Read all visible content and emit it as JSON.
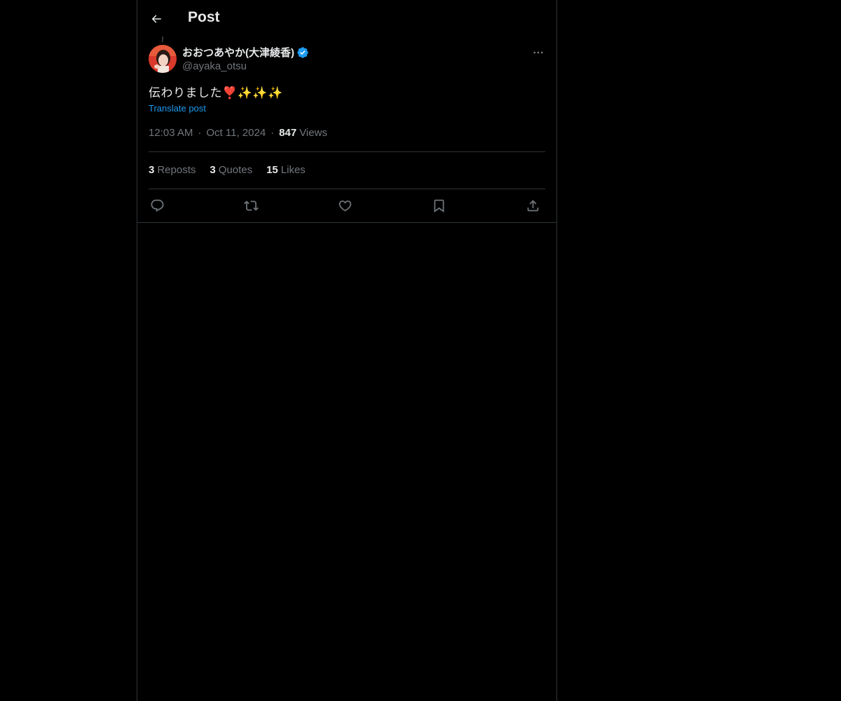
{
  "header": {
    "title": "Post",
    "back_icon": "arrow-left-icon"
  },
  "post": {
    "author": {
      "display_name": "おおつあやか(大津綾香)",
      "handle": "@ayaka_otsu",
      "verified": true
    },
    "text": "伝わりました❣️✨✨✨",
    "translate_label": "Translate post",
    "time": "12:03 AM",
    "date": "Oct 11, 2024",
    "views_count": "847",
    "views_label": "Views"
  },
  "stats": [
    {
      "count": "3",
      "label": "Reposts"
    },
    {
      "count": "3",
      "label": "Quotes"
    },
    {
      "count": "15",
      "label": "Likes"
    }
  ],
  "actions": [
    {
      "name": "reply",
      "icon": "reply-icon"
    },
    {
      "name": "repost",
      "icon": "repost-icon"
    },
    {
      "name": "like",
      "icon": "heart-icon"
    },
    {
      "name": "bookmark",
      "icon": "bookmark-icon"
    },
    {
      "name": "share",
      "icon": "share-icon"
    }
  ],
  "colors": {
    "background": "#000000",
    "text": "#e7e9ea",
    "muted": "#71767b",
    "accent": "#1d9bf0",
    "border": "#2f3336"
  },
  "meta_separator": "·"
}
